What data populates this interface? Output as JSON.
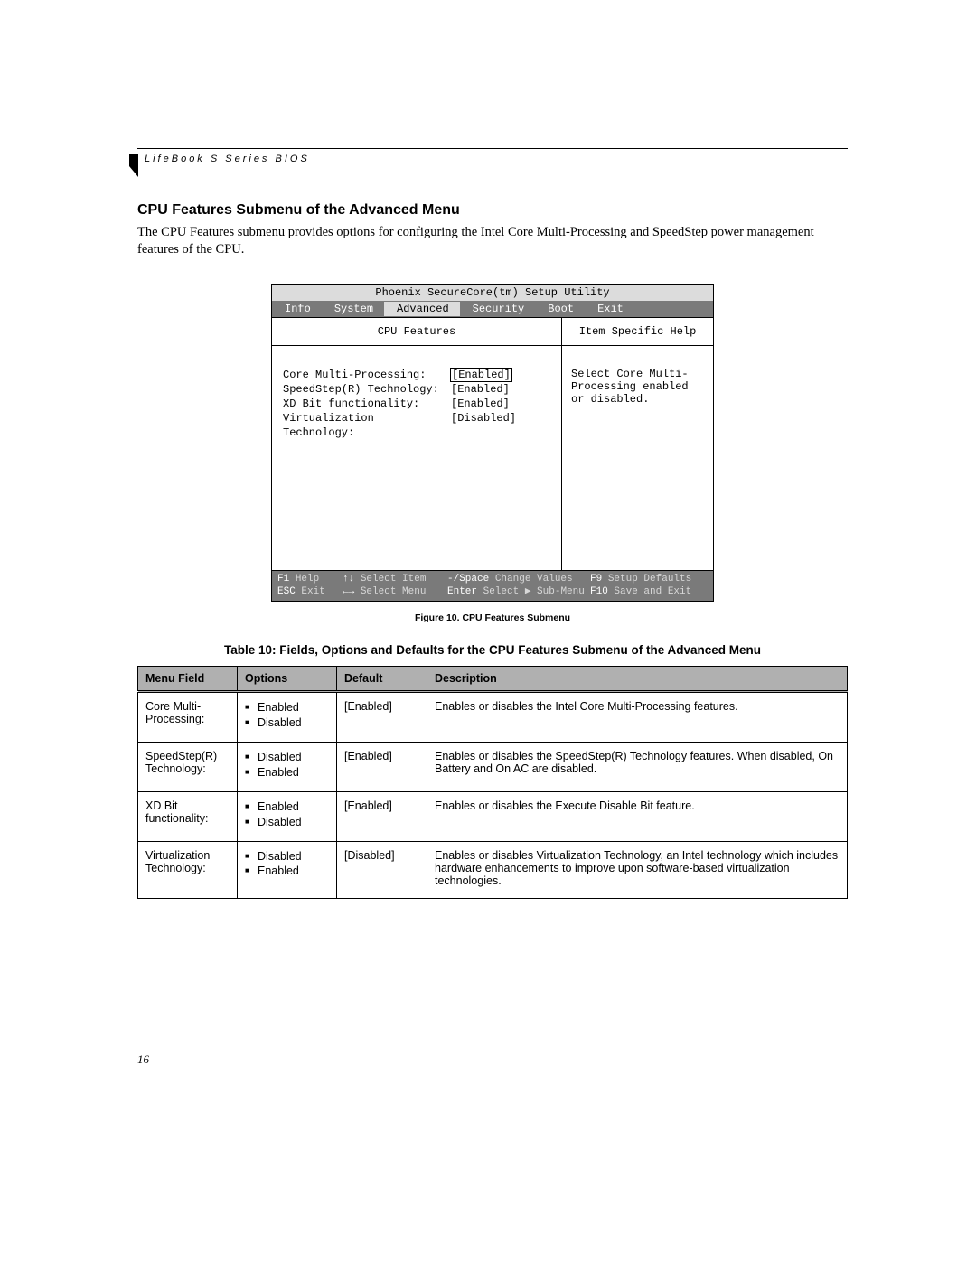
{
  "header": {
    "text": "LifeBook S Series BIOS"
  },
  "section": {
    "title": "CPU Features Submenu of the Advanced Menu",
    "body": "The CPU Features submenu provides options for configuring the Intel Core Multi-Processing and SpeedStep power management features of the CPU."
  },
  "bios": {
    "title": "Phoenix SecureCore(tm) Setup Utility",
    "tabs": [
      "Info",
      "System",
      "Advanced",
      "Security",
      "Boot",
      "Exit"
    ],
    "active_tab_index": 2,
    "panel_left_title": "CPU Features",
    "panel_right_title": "Item Specific Help",
    "settings": [
      {
        "label": "Core Multi-Processing:",
        "value": "[Enabled]",
        "selected": true
      },
      {
        "label": "SpeedStep(R) Technology:",
        "value": "[Enabled]",
        "selected": false
      },
      {
        "label": "XD Bit functionality:",
        "value": "[Enabled]",
        "selected": false
      },
      {
        "label": "Virtualization Technology:",
        "value": "[Disabled]",
        "selected": false
      }
    ],
    "help_text": "Select Core Multi-Processing enabled or disabled.",
    "footer": {
      "row1": [
        {
          "key": "F1",
          "label": "Help"
        },
        {
          "key": "↑↓",
          "label": "Select Item"
        },
        {
          "key": "-/Space",
          "label": "Change Values"
        },
        {
          "key": "F9",
          "label": "Setup Defaults"
        }
      ],
      "row2": [
        {
          "key": "ESC",
          "label": "Exit"
        },
        {
          "key": "←→",
          "label": "Select Menu"
        },
        {
          "key": "Enter",
          "label": "Select ▶ Sub-Menu"
        },
        {
          "key": "F10",
          "label": "Save and Exit"
        }
      ]
    }
  },
  "figure_caption": "Figure 10.  CPU Features Submenu",
  "table_caption": "Table 10: Fields, Options and Defaults for the CPU Features Submenu of the Advanced Menu",
  "table": {
    "headers": [
      "Menu Field",
      "Options",
      "Default",
      "Description"
    ],
    "rows": [
      {
        "field": "Core Multi-Processing:",
        "options": [
          "Enabled",
          "Disabled"
        ],
        "default": "[Enabled]",
        "description": "Enables or disables the Intel Core Multi-Processing features."
      },
      {
        "field": "SpeedStep(R) Technology:",
        "options": [
          "Disabled",
          "Enabled"
        ],
        "default": "[Enabled]",
        "description": "Enables or disables the SpeedStep(R) Technology features. When disabled, On Battery and On AC are disabled."
      },
      {
        "field": "XD Bit functionality:",
        "options": [
          "Enabled",
          "Disabled"
        ],
        "default": "[Enabled]",
        "description": "Enables or disables the Execute Disable Bit feature."
      },
      {
        "field": "Virtualization Technology:",
        "options": [
          "Disabled",
          "Enabled"
        ],
        "default": "[Disabled]",
        "description": "Enables or disables Virtualization Technology, an Intel technology which includes hardware enhancements to improve upon software-based virtualization technologies."
      }
    ]
  },
  "page_number": "16"
}
